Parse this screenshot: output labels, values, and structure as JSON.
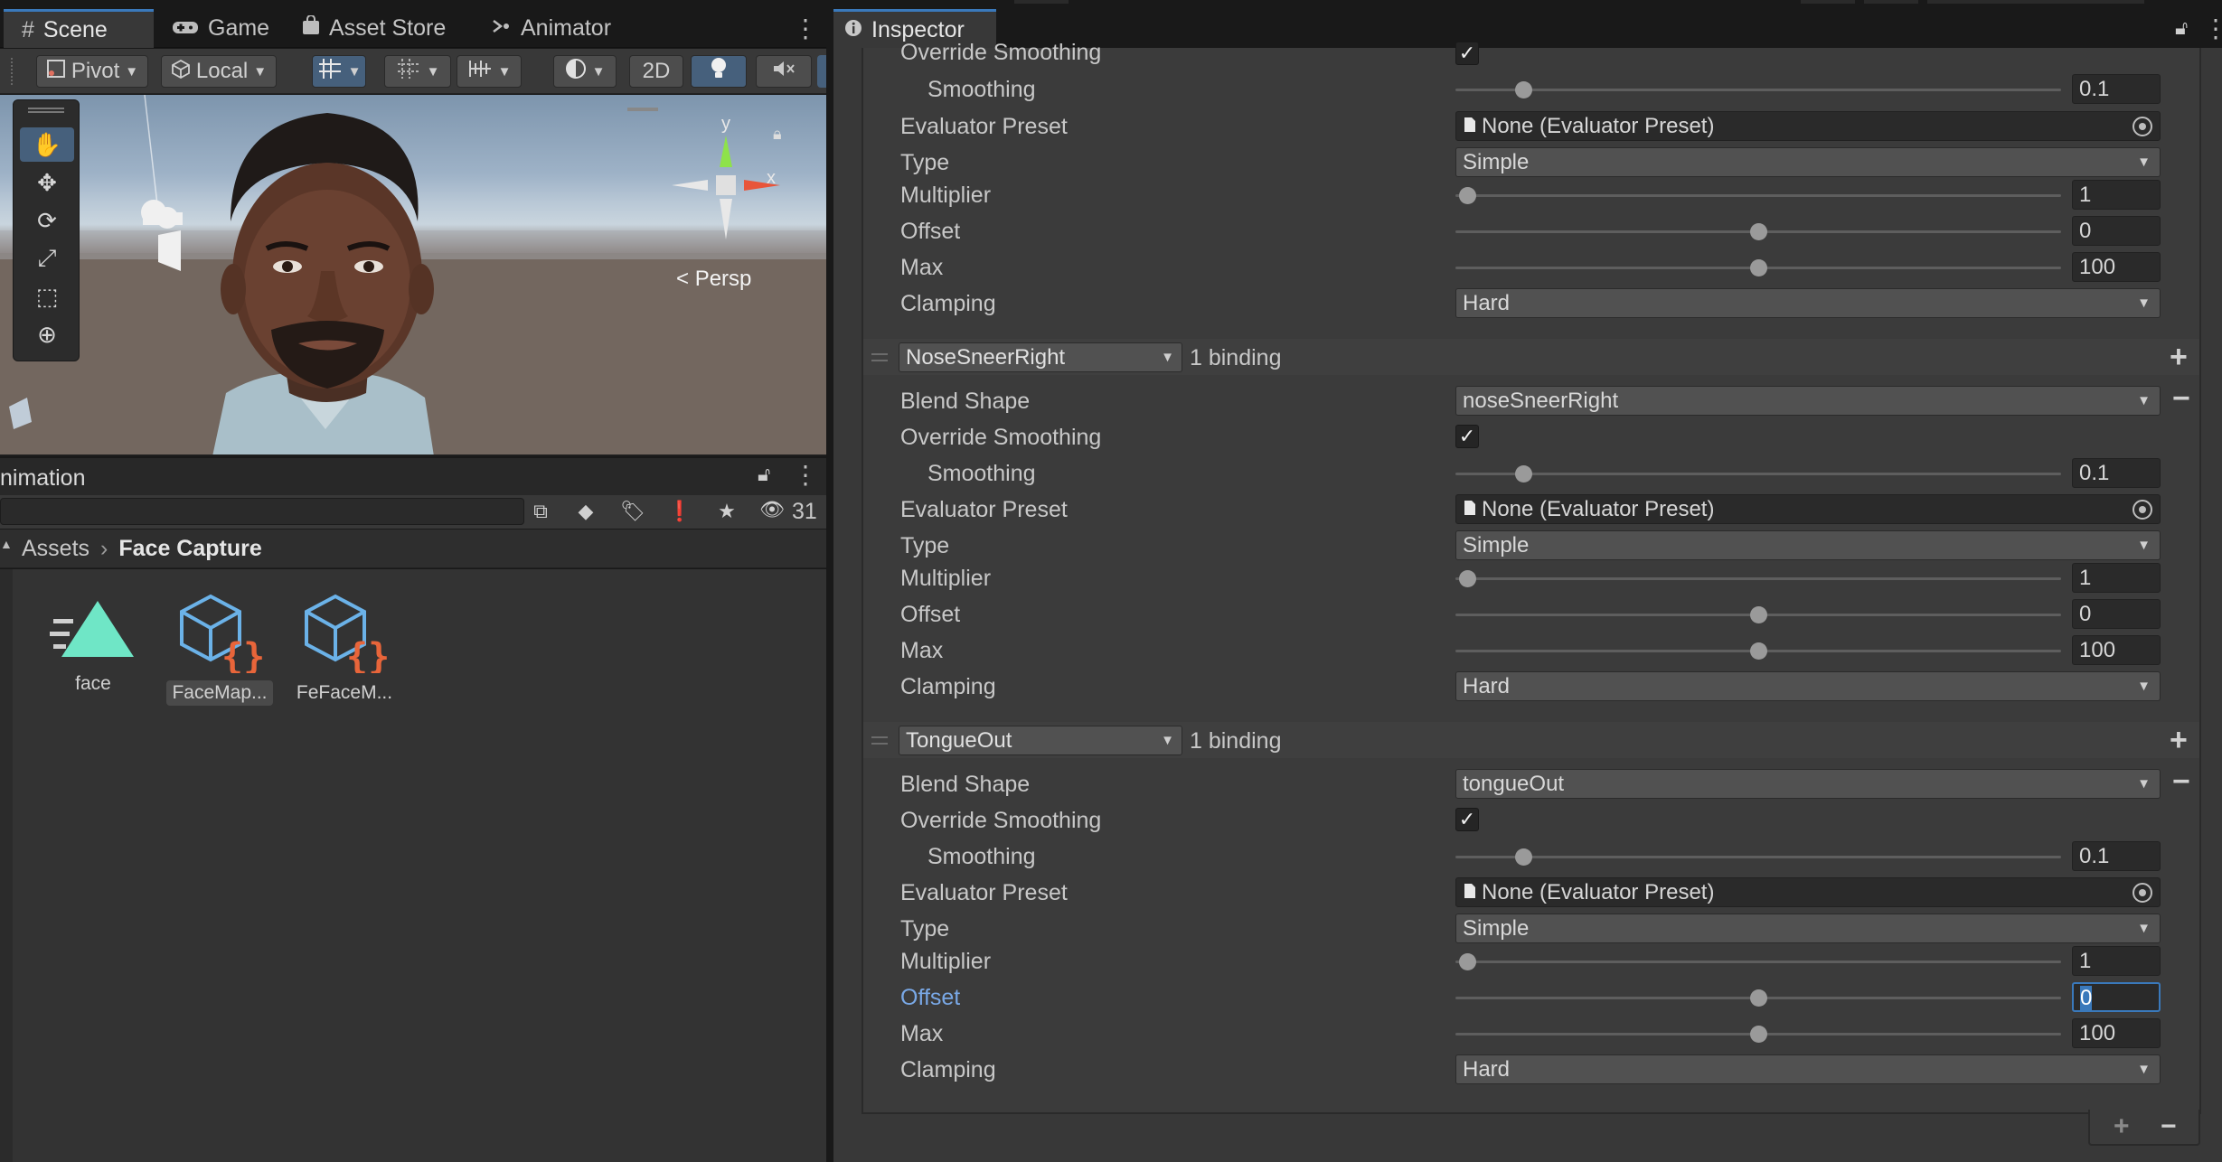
{
  "scene_tabs": [
    {
      "icon": "#",
      "label": "Scene"
    },
    {
      "icon": "game-controller",
      "label": "Game"
    },
    {
      "icon": "shopping-bag",
      "label": "Asset Store"
    },
    {
      "icon": "animator",
      "label": "Animator"
    }
  ],
  "inspector_tab": {
    "label": "Inspector"
  },
  "scene_toolbar": {
    "pivot": "Pivot",
    "local": "Local",
    "mode_2d": "2D"
  },
  "scene_view": {
    "projection": "Persp",
    "gizmo_y": "y",
    "gizmo_x": "x"
  },
  "project": {
    "title": "nimation",
    "hidden_count": "31",
    "breadcrumb": {
      "root": "Assets",
      "current": "Face Capture"
    },
    "assets": [
      {
        "label": "face",
        "icon": "animation-clip-icon",
        "selected": false
      },
      {
        "label": "FaceMap...",
        "icon": "scriptable-object-icon",
        "selected": true
      },
      {
        "label": "FeFaceM...",
        "icon": "scriptable-object-icon",
        "selected": false
      }
    ]
  },
  "inspector": {
    "top_group": {
      "override_smoothing_label": "Override Smoothing",
      "override_smoothing_checked": true,
      "smoothing_label": "Smoothing",
      "smoothing_value": "0.1",
      "evaluator_preset_label": "Evaluator Preset",
      "evaluator_preset_value": "None (Evaluator Preset)",
      "type_label": "Type",
      "type_value": "Simple",
      "multiplier_label": "Multiplier",
      "multiplier_value": "1",
      "offset_label": "Offset",
      "offset_value": "0",
      "max_label": "Max",
      "max_value": "100",
      "clamping_label": "Clamping",
      "clamping_value": "Hard"
    },
    "bindings": [
      {
        "name": "NoseSneerRight",
        "count_label": "1 binding",
        "blend_shape_label": "Blend Shape",
        "blend_shape_value": "noseSneerRight",
        "override_smoothing_label": "Override Smoothing",
        "override_smoothing_checked": true,
        "smoothing_label": "Smoothing",
        "smoothing_value": "0.1",
        "evaluator_preset_label": "Evaluator Preset",
        "evaluator_preset_value": "None (Evaluator Preset)",
        "type_label": "Type",
        "type_value": "Simple",
        "multiplier_label": "Multiplier",
        "multiplier_value": "1",
        "offset_label": "Offset",
        "offset_value": "0",
        "max_label": "Max",
        "max_value": "100",
        "clamping_label": "Clamping",
        "clamping_value": "Hard"
      },
      {
        "name": "TongueOut",
        "count_label": "1 binding",
        "blend_shape_label": "Blend Shape",
        "blend_shape_value": "tongueOut",
        "override_smoothing_label": "Override Smoothing",
        "override_smoothing_checked": true,
        "smoothing_label": "Smoothing",
        "smoothing_value": "0.1",
        "evaluator_preset_label": "Evaluator Preset",
        "evaluator_preset_value": "None (Evaluator Preset)",
        "type_label": "Type",
        "type_value": "Simple",
        "multiplier_label": "Multiplier",
        "multiplier_value": "1",
        "offset_label": "Offset",
        "offset_value": "0",
        "max_label": "Max",
        "max_value": "100",
        "clamping_label": "Clamping",
        "clamping_value": "Hard"
      }
    ],
    "plus": "+",
    "minus": "−",
    "check": "✓"
  },
  "colors": {
    "accent_blue": "#3a79bb",
    "focused_label": "#79a8e6",
    "panel_bg": "#383838"
  }
}
